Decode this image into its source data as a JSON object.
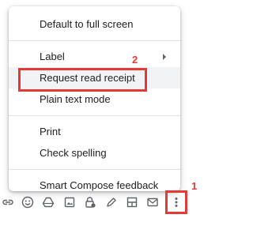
{
  "menu": {
    "items": [
      {
        "label": "Default to full screen"
      },
      {
        "label": "Label"
      },
      {
        "label": "Request read receipt"
      },
      {
        "label": "Plain text mode"
      },
      {
        "label": "Print"
      },
      {
        "label": "Check spelling"
      },
      {
        "label": "Smart Compose feedback"
      }
    ]
  },
  "annotations": {
    "step1": "1",
    "step2": "2",
    "color": "#e53935"
  },
  "toolbar": {
    "icons": [
      "link-icon",
      "emoji-icon",
      "drive-icon",
      "photo-icon",
      "lock-clock-icon",
      "pen-icon",
      "layout-icon",
      "envelope-icon",
      "more-vert-icon"
    ]
  }
}
